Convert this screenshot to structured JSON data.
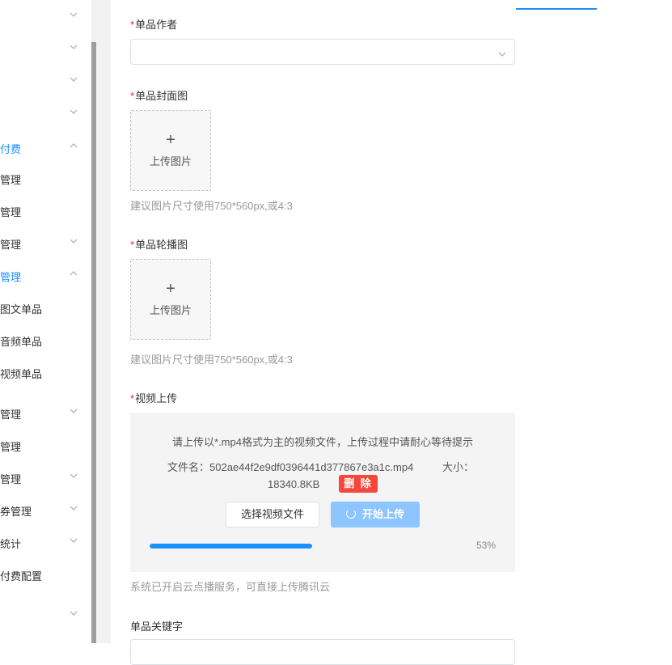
{
  "sidebar": {
    "items": [
      {
        "label": "",
        "active": false,
        "chevron": "down"
      },
      {
        "label": "",
        "active": false,
        "chevron": "down"
      },
      {
        "label": "",
        "active": false,
        "chevron": "down"
      },
      {
        "label": "",
        "active": false,
        "chevron": "down"
      },
      {
        "label": "付费",
        "active": true,
        "chevron": "up"
      },
      {
        "label": "管理",
        "active": false,
        "chevron": ""
      },
      {
        "label": "管理",
        "active": false,
        "chevron": ""
      },
      {
        "label": "管理",
        "active": false,
        "chevron": "down"
      },
      {
        "label": "管理",
        "active": true,
        "chevron": "up"
      },
      {
        "label": "图文单品",
        "active": false,
        "chevron": ""
      },
      {
        "label": "音频单品",
        "active": false,
        "chevron": ""
      },
      {
        "label": "视频单品",
        "active": false,
        "chevron": ""
      },
      {
        "label": "管理",
        "active": false,
        "chevron": "down"
      },
      {
        "label": "管理",
        "active": false,
        "chevron": ""
      },
      {
        "label": "管理",
        "active": false,
        "chevron": "down"
      },
      {
        "label": "券管理",
        "active": false,
        "chevron": "down"
      },
      {
        "label": "统计",
        "active": false,
        "chevron": "down"
      },
      {
        "label": "付费配置",
        "active": false,
        "chevron": ""
      },
      {
        "label": "",
        "active": false,
        "chevron": "down"
      }
    ]
  },
  "form": {
    "required_mark": "*",
    "author": {
      "label": "单品作者",
      "value": "",
      "icon": "chevron-down-icon"
    },
    "cover": {
      "label": "单品封面图",
      "upload_text": "上传图片",
      "hint": "建议图片尺寸使用750*560px,或4:3"
    },
    "carousel": {
      "label": "单品轮播图",
      "upload_text": "上传图片",
      "hint": "建议图片尺寸使用750*560px,或4:3"
    },
    "video": {
      "label": "视频上传",
      "prompt": "请上传以*.mp4格式为主的视频文件，上传过程中请耐心等待提示",
      "file_name_text": "文件名：502ae44f2e9df0396441d377867e3a1c.mp4",
      "size_label": "大小：",
      "size_value": "18340.8KB",
      "delete_label": "删 除",
      "choose_label": "选择视频文件",
      "start_label": "开始上传",
      "progress_percent": 53,
      "progress_text": "53%",
      "hint": "系统已开启云点播服务，可直接上传腾讯云"
    },
    "keyword": {
      "label": "单品关键字",
      "value": ""
    }
  },
  "colors": {
    "accent": "#1890ff",
    "danger": "#f5483b",
    "required": "#f5222d",
    "start_button": "#8cc5ff"
  }
}
